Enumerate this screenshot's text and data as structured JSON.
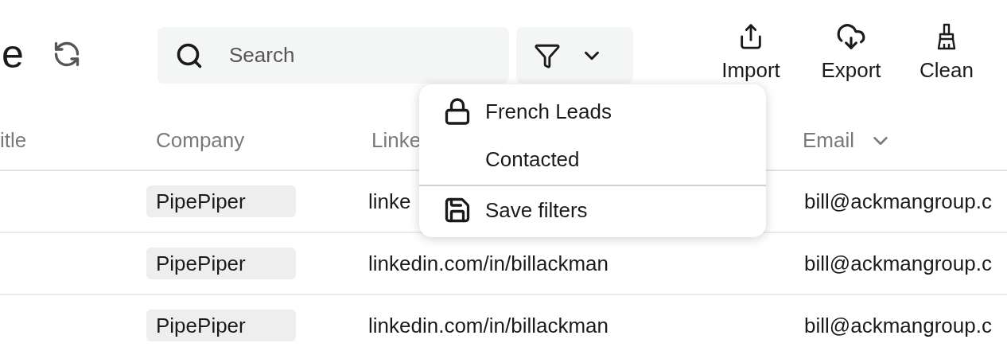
{
  "header": {
    "title": "e",
    "search": {
      "placeholder": "Search"
    }
  },
  "actions": [
    {
      "label": "Import",
      "kind": "import"
    },
    {
      "label": "Export",
      "kind": "export"
    },
    {
      "label": "Clean",
      "kind": "clean"
    }
  ],
  "table": {
    "columns": [
      {
        "label": "itle",
        "kind": "plain"
      },
      {
        "label": "Company",
        "kind": "plain"
      },
      {
        "label": "Linke",
        "kind": "plain"
      },
      {
        "label": "Email",
        "kind": "dropdown"
      }
    ],
    "rows": [
      [
        "",
        "PipePiper",
        "linke",
        "bill@ackmangroup.c"
      ],
      [
        "",
        "PipePiper",
        "linkedin.com/in/billackman",
        "bill@ackmangroup.c"
      ],
      [
        "",
        "PipePiper",
        "linkedin.com/in/billackman",
        "bill@ackmangroup.c"
      ]
    ]
  },
  "filter_menu": {
    "items": [
      {
        "label": "French Leads",
        "kind": "locked"
      },
      {
        "label": "Contacted",
        "kind": "plain"
      },
      {
        "label": "Save filters",
        "kind": "save"
      }
    ]
  }
}
